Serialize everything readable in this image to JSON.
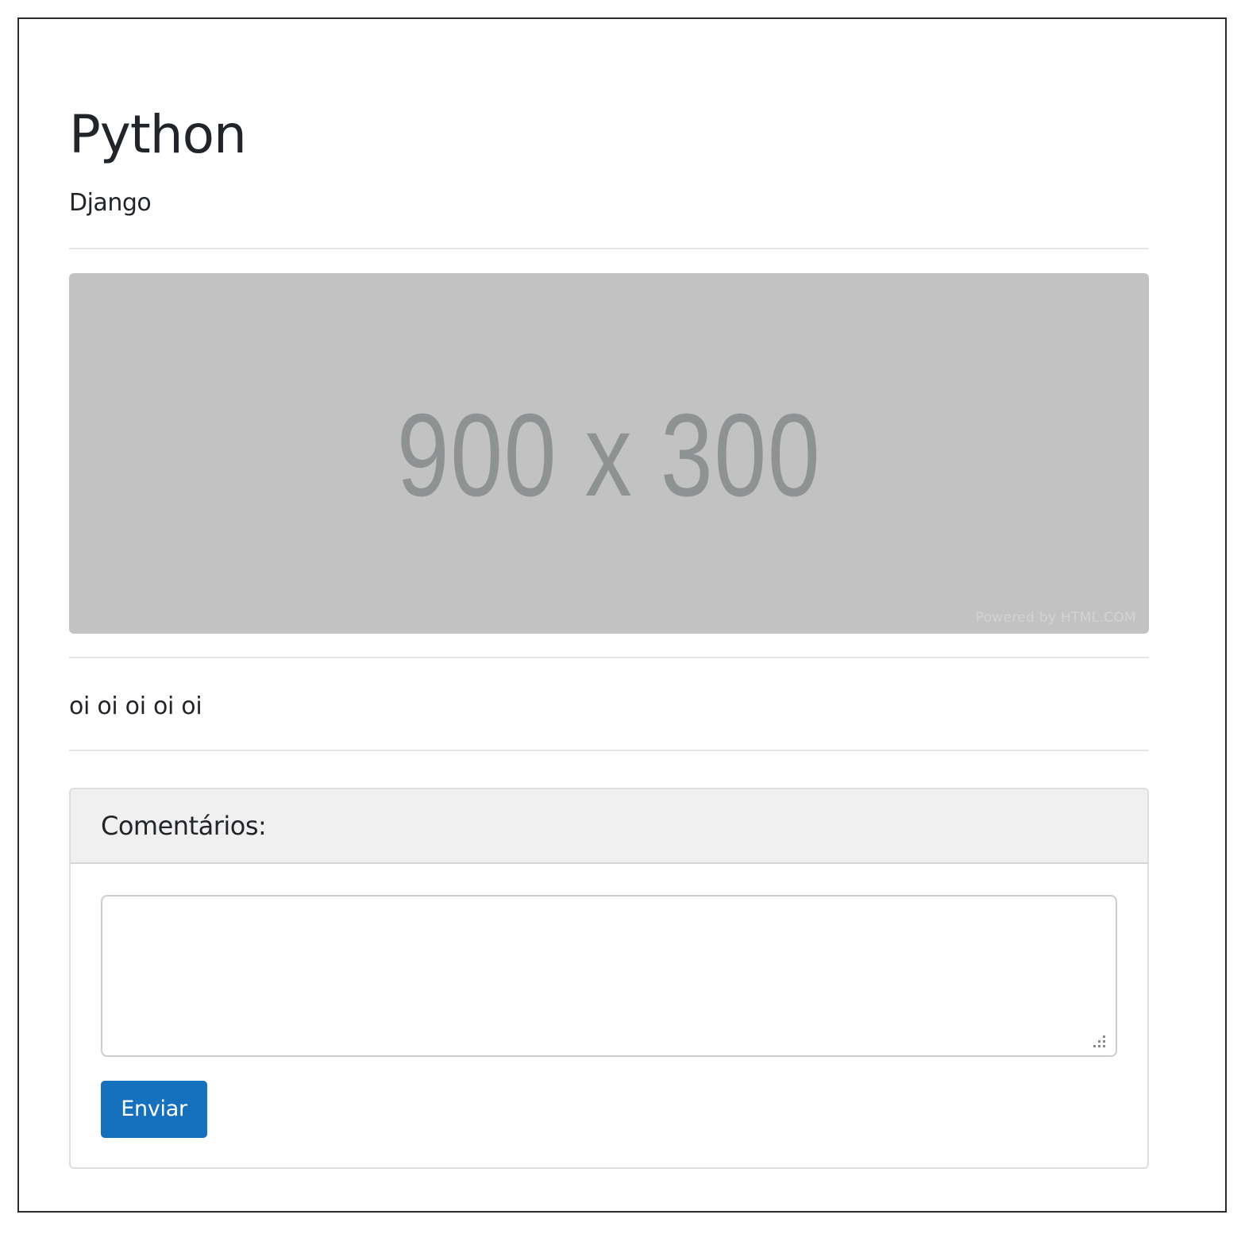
{
  "post": {
    "title": "Python",
    "subtitle": "Django",
    "image": {
      "size_label": "900 x 300",
      "credit": "Powered by HTML.COM"
    },
    "body": "oi oi oi oi oi"
  },
  "comments": {
    "header": "Comentários:",
    "textarea_value": "",
    "textarea_placeholder": "",
    "submit_label": "Enviar"
  },
  "colors": {
    "button": "#1570bd",
    "placeholder_bg": "#c2c2c2",
    "placeholder_text": "#8f9293",
    "card_header_bg": "#f0f0f0"
  }
}
